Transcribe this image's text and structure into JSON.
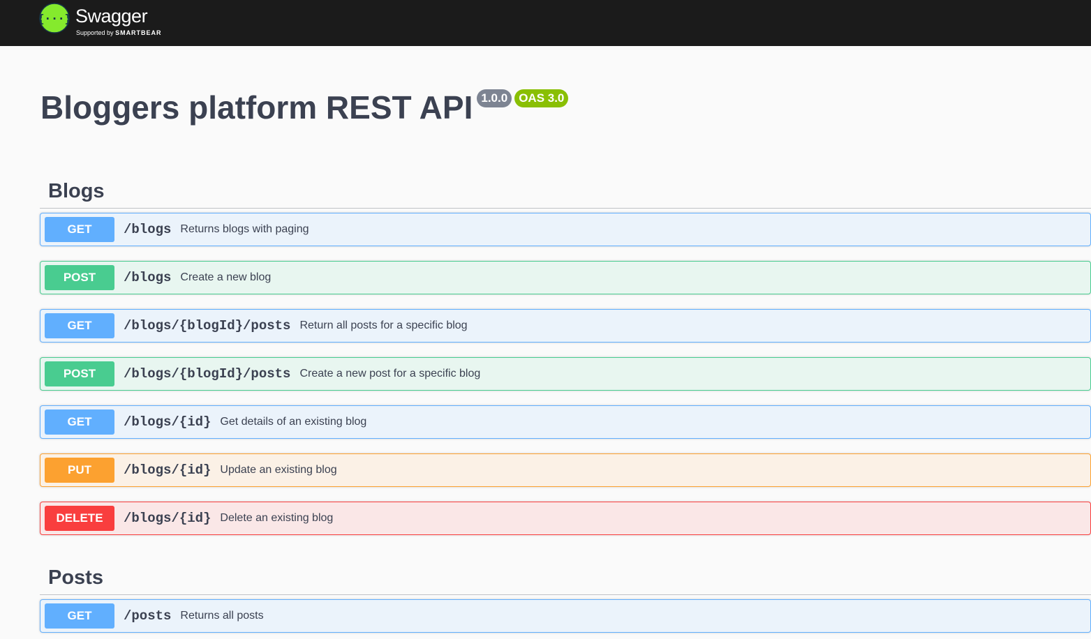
{
  "header": {
    "logo_word": "Swagger",
    "logo_tm": ".",
    "logo_sub_prefix": "Supported by",
    "logo_sub_brand": "SMARTBEAR"
  },
  "info": {
    "title": "Bloggers platform REST API",
    "version": "1.0.0",
    "oas": "OAS 3.0"
  },
  "colors": {
    "get": "#61affe",
    "post": "#49cc90",
    "put": "#fca130",
    "delete": "#f93e3e",
    "topbar": "#1b1b1b",
    "logo_green": "#85ea2d"
  },
  "tags": [
    {
      "name": "Blogs",
      "operations": [
        {
          "method": "GET",
          "path": "/blogs",
          "summary": "Returns blogs with paging"
        },
        {
          "method": "POST",
          "path": "/blogs",
          "summary": "Create a new blog"
        },
        {
          "method": "GET",
          "path": "/blogs/{blogId}/posts",
          "summary": "Return all posts for a specific blog"
        },
        {
          "method": "POST",
          "path": "/blogs/{blogId}/posts",
          "summary": "Create a new post for a specific blog"
        },
        {
          "method": "GET",
          "path": "/blogs/{id}",
          "summary": "Get details of an existing blog"
        },
        {
          "method": "PUT",
          "path": "/blogs/{id}",
          "summary": "Update an existing blog"
        },
        {
          "method": "DELETE",
          "path": "/blogs/{id}",
          "summary": "Delete an existing blog"
        }
      ]
    },
    {
      "name": "Posts",
      "operations": [
        {
          "method": "GET",
          "path": "/posts",
          "summary": "Returns all posts"
        }
      ]
    }
  ]
}
